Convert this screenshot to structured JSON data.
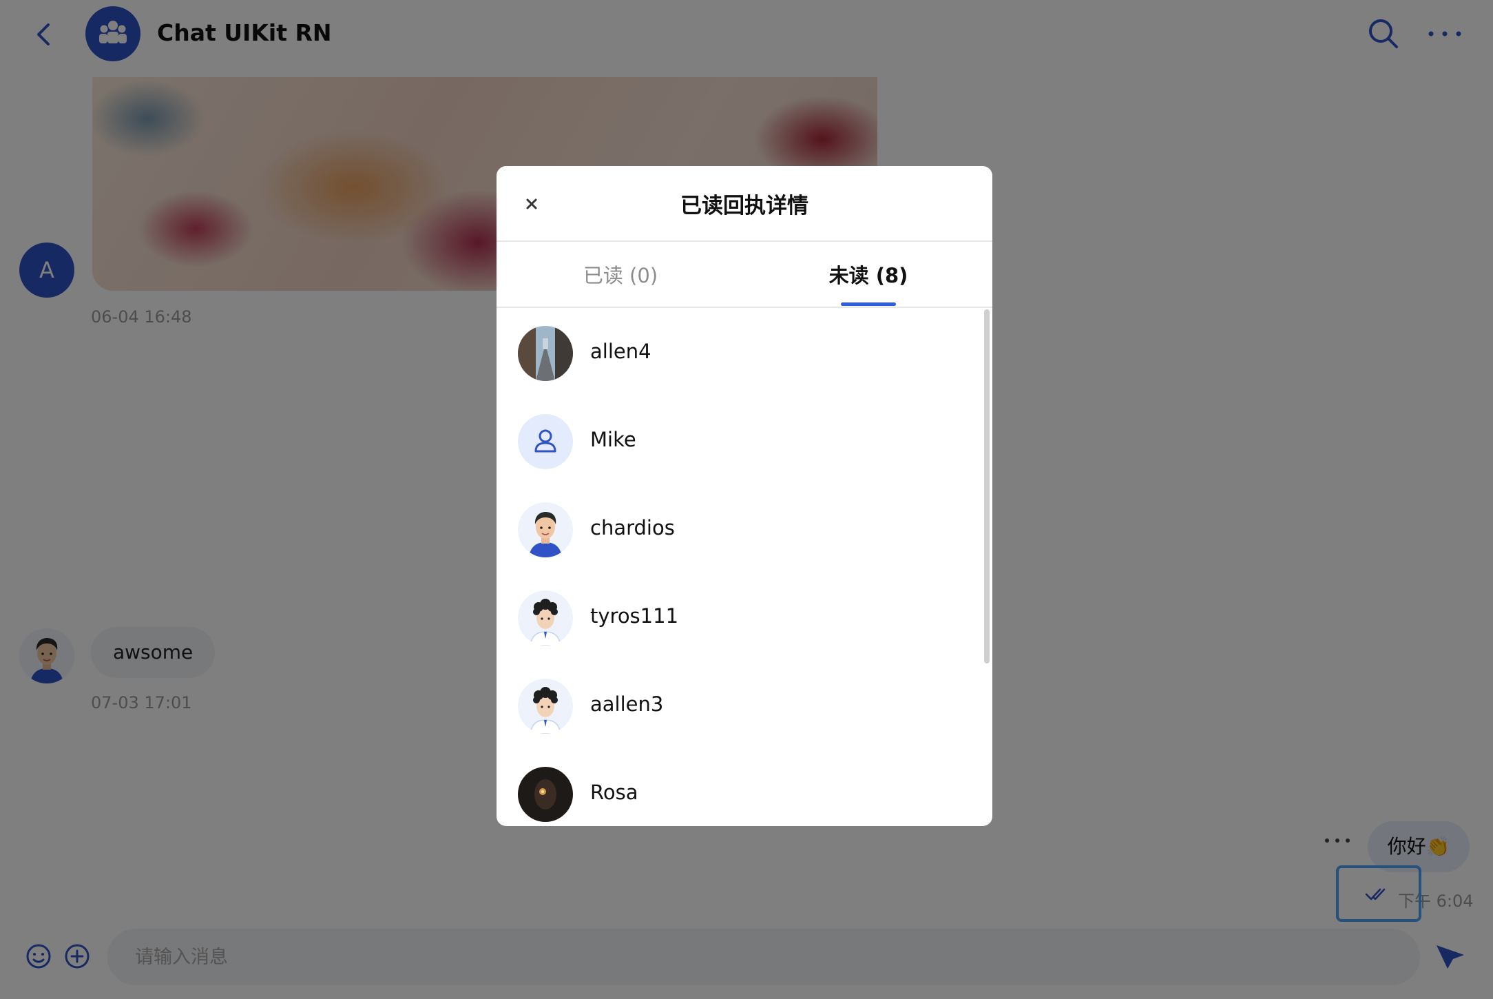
{
  "header": {
    "title": "Chat UIKit RN"
  },
  "messages": [
    {
      "sender_initial": "A",
      "type": "image",
      "time": "06-04 16:48"
    },
    {
      "type": "text",
      "text": "awsome",
      "time": "07-03 17:01"
    },
    {
      "type": "text",
      "text": "你好👏",
      "time": "下午 6:04",
      "outgoing": true
    }
  ],
  "composer": {
    "placeholder": "请输入消息"
  },
  "modal": {
    "title": "已读回执详情",
    "tabs": [
      {
        "label": "已读 (0)",
        "active": false
      },
      {
        "label": "未读 (8)",
        "active": true
      }
    ],
    "members": [
      {
        "name": "allen4",
        "avatar": "street-photo"
      },
      {
        "name": "Mike",
        "avatar": "default-person-icon"
      },
      {
        "name": "chardios",
        "avatar": "cartoon-man"
      },
      {
        "name": "tyros111",
        "avatar": "cartoon-curly-hair"
      },
      {
        "name": "aallen3",
        "avatar": "cartoon-curly-hair"
      },
      {
        "name": "Rosa",
        "avatar": "dark-photo"
      }
    ]
  },
  "colors": {
    "accent": "#2f5ee0",
    "avatar_blue": "#2f53c6",
    "highlight_border": "#4aa3f7",
    "overlay": "rgba(0,0,0,0.5)"
  }
}
